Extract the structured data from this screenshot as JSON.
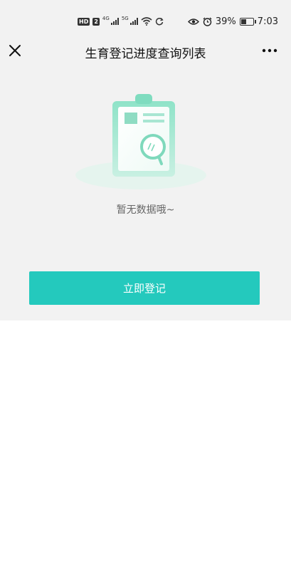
{
  "status_bar": {
    "hd_badge": "HD",
    "sim_number": "2",
    "network_1": "4G",
    "network_2": "5G",
    "battery_percent": "39%",
    "time": "7:03",
    "icons": [
      "hd-icon",
      "signal-icon",
      "wifi-icon",
      "sync-icon",
      "eye-icon",
      "alarm-icon",
      "battery-icon"
    ]
  },
  "header": {
    "title": "生育登记进度查询列表",
    "close_icon": "close-icon",
    "more_icon": "more-icon"
  },
  "empty_state": {
    "message": "暂无数据哦~",
    "illustration_icon": "clipboard-search-icon"
  },
  "actions": {
    "register_label": "立即登记"
  },
  "colors": {
    "accent": "#24c9bd",
    "top_background": "#f2f2f2",
    "illustration_green": "#6fd9b8"
  }
}
